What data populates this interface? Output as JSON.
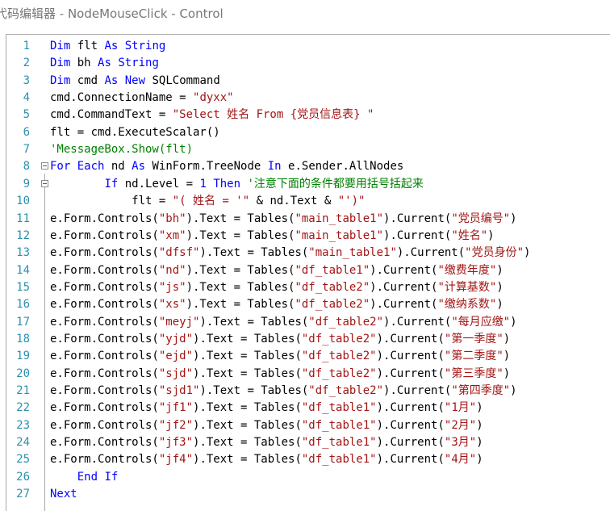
{
  "window": {
    "title": "代码编辑器 - NodeMouseClick - Control"
  },
  "colors": {
    "keyword": "#0000ff",
    "string": "#a31515",
    "comment": "#008000",
    "line_number": "#2b91af",
    "text": "#000000"
  },
  "editor": {
    "lines": [
      {
        "n": "1",
        "fold": "",
        "segs": [
          {
            "t": "Dim",
            "c": "kw"
          },
          {
            "t": " flt ",
            "c": "pl"
          },
          {
            "t": "As",
            "c": "kw"
          },
          {
            "t": " ",
            "c": "pl"
          },
          {
            "t": "String",
            "c": "kw"
          }
        ]
      },
      {
        "n": "2",
        "fold": "",
        "segs": [
          {
            "t": "Dim",
            "c": "kw"
          },
          {
            "t": " bh ",
            "c": "pl"
          },
          {
            "t": "As",
            "c": "kw"
          },
          {
            "t": " ",
            "c": "pl"
          },
          {
            "t": "String",
            "c": "kw"
          }
        ]
      },
      {
        "n": "3",
        "fold": "",
        "segs": [
          {
            "t": "Dim",
            "c": "kw"
          },
          {
            "t": " cmd ",
            "c": "pl"
          },
          {
            "t": "As",
            "c": "kw"
          },
          {
            "t": " ",
            "c": "pl"
          },
          {
            "t": "New",
            "c": "kw"
          },
          {
            "t": " SQLCommand",
            "c": "pl"
          }
        ]
      },
      {
        "n": "4",
        "fold": "",
        "segs": [
          {
            "t": "cmd.ConnectionName = ",
            "c": "pl"
          },
          {
            "t": "\"dyxx\"",
            "c": "str"
          }
        ]
      },
      {
        "n": "5",
        "fold": "",
        "segs": [
          {
            "t": "cmd.CommandText = ",
            "c": "pl"
          },
          {
            "t": "\"Select 姓名 From {党员信息表} \"",
            "c": "str"
          }
        ]
      },
      {
        "n": "6",
        "fold": "",
        "segs": [
          {
            "t": "flt = cmd.ExecuteScalar()",
            "c": "pl"
          }
        ]
      },
      {
        "n": "7",
        "fold": "",
        "segs": [
          {
            "t": "'MessageBox.Show(flt)",
            "c": "cmt"
          }
        ]
      },
      {
        "n": "8",
        "fold": "box",
        "segs": [
          {
            "t": "For",
            "c": "kw"
          },
          {
            "t": " ",
            "c": "pl"
          },
          {
            "t": "Each",
            "c": "kw"
          },
          {
            "t": " nd ",
            "c": "pl"
          },
          {
            "t": "As",
            "c": "kw"
          },
          {
            "t": " WinForm.TreeNode ",
            "c": "pl"
          },
          {
            "t": "In",
            "c": "kw"
          },
          {
            "t": " e.Sender.AllNodes",
            "c": "pl"
          }
        ]
      },
      {
        "n": "9",
        "fold": "box",
        "segs": [
          {
            "t": "        ",
            "c": "pl"
          },
          {
            "t": "If",
            "c": "kw"
          },
          {
            "t": " nd.Level = ",
            "c": "pl"
          },
          {
            "t": "1",
            "c": "num"
          },
          {
            "t": " ",
            "c": "pl"
          },
          {
            "t": "Then",
            "c": "kw"
          },
          {
            "t": " '注意下面的条件都要用括号括起来",
            "c": "cmt"
          }
        ]
      },
      {
        "n": "10",
        "fold": "",
        "segs": [
          {
            "t": "            flt = ",
            "c": "pl"
          },
          {
            "t": "\"( 姓名 = '\"",
            "c": "str"
          },
          {
            "t": " & nd.Text & ",
            "c": "pl"
          },
          {
            "t": "\"')\"",
            "c": "str"
          }
        ]
      },
      {
        "n": "11",
        "fold": "",
        "segs": [
          {
            "t": "e.Form.Controls(",
            "c": "pl"
          },
          {
            "t": "\"bh\"",
            "c": "str"
          },
          {
            "t": ").Text = Tables(",
            "c": "pl"
          },
          {
            "t": "\"main_table1\"",
            "c": "str"
          },
          {
            "t": ").Current(",
            "c": "pl"
          },
          {
            "t": "\"党员编号\"",
            "c": "str"
          },
          {
            "t": ")",
            "c": "pl"
          }
        ]
      },
      {
        "n": "12",
        "fold": "",
        "segs": [
          {
            "t": "e.Form.Controls(",
            "c": "pl"
          },
          {
            "t": "\"xm\"",
            "c": "str"
          },
          {
            "t": ").Text = Tables(",
            "c": "pl"
          },
          {
            "t": "\"main_table1\"",
            "c": "str"
          },
          {
            "t": ").Current(",
            "c": "pl"
          },
          {
            "t": "\"姓名\"",
            "c": "str"
          },
          {
            "t": ")",
            "c": "pl"
          }
        ]
      },
      {
        "n": "13",
        "fold": "",
        "segs": [
          {
            "t": "e.Form.Controls(",
            "c": "pl"
          },
          {
            "t": "\"dfsf\"",
            "c": "str"
          },
          {
            "t": ").Text = Tables(",
            "c": "pl"
          },
          {
            "t": "\"main_table1\"",
            "c": "str"
          },
          {
            "t": ").Current(",
            "c": "pl"
          },
          {
            "t": "\"党员身份\"",
            "c": "str"
          },
          {
            "t": ")",
            "c": "pl"
          }
        ]
      },
      {
        "n": "14",
        "fold": "",
        "segs": [
          {
            "t": "e.Form.Controls(",
            "c": "pl"
          },
          {
            "t": "\"nd\"",
            "c": "str"
          },
          {
            "t": ").Text = Tables(",
            "c": "pl"
          },
          {
            "t": "\"df_table1\"",
            "c": "str"
          },
          {
            "t": ").Current(",
            "c": "pl"
          },
          {
            "t": "\"缴费年度\"",
            "c": "str"
          },
          {
            "t": ")",
            "c": "pl"
          }
        ]
      },
      {
        "n": "15",
        "fold": "",
        "segs": [
          {
            "t": "e.Form.Controls(",
            "c": "pl"
          },
          {
            "t": "\"js\"",
            "c": "str"
          },
          {
            "t": ").Text = Tables(",
            "c": "pl"
          },
          {
            "t": "\"df_table2\"",
            "c": "str"
          },
          {
            "t": ").Current(",
            "c": "pl"
          },
          {
            "t": "\"计算基数\"",
            "c": "str"
          },
          {
            "t": ")",
            "c": "pl"
          }
        ]
      },
      {
        "n": "16",
        "fold": "",
        "segs": [
          {
            "t": "e.Form.Controls(",
            "c": "pl"
          },
          {
            "t": "\"xs\"",
            "c": "str"
          },
          {
            "t": ").Text = Tables(",
            "c": "pl"
          },
          {
            "t": "\"df_table2\"",
            "c": "str"
          },
          {
            "t": ").Current(",
            "c": "pl"
          },
          {
            "t": "\"缴纳系数\"",
            "c": "str"
          },
          {
            "t": ")",
            "c": "pl"
          }
        ]
      },
      {
        "n": "17",
        "fold": "",
        "segs": [
          {
            "t": "e.Form.Controls(",
            "c": "pl"
          },
          {
            "t": "\"meyj\"",
            "c": "str"
          },
          {
            "t": ").Text = Tables(",
            "c": "pl"
          },
          {
            "t": "\"df_table2\"",
            "c": "str"
          },
          {
            "t": ").Current(",
            "c": "pl"
          },
          {
            "t": "\"每月应缴\"",
            "c": "str"
          },
          {
            "t": ")",
            "c": "pl"
          }
        ]
      },
      {
        "n": "18",
        "fold": "",
        "segs": [
          {
            "t": "e.Form.Controls(",
            "c": "pl"
          },
          {
            "t": "\"yjd\"",
            "c": "str"
          },
          {
            "t": ").Text = Tables(",
            "c": "pl"
          },
          {
            "t": "\"df_table2\"",
            "c": "str"
          },
          {
            "t": ").Current(",
            "c": "pl"
          },
          {
            "t": "\"第一季度\"",
            "c": "str"
          },
          {
            "t": ")",
            "c": "pl"
          }
        ]
      },
      {
        "n": "19",
        "fold": "",
        "segs": [
          {
            "t": "e.Form.Controls(",
            "c": "pl"
          },
          {
            "t": "\"ejd\"",
            "c": "str"
          },
          {
            "t": ").Text = Tables(",
            "c": "pl"
          },
          {
            "t": "\"df_table2\"",
            "c": "str"
          },
          {
            "t": ").Current(",
            "c": "pl"
          },
          {
            "t": "\"第二季度\"",
            "c": "str"
          },
          {
            "t": ")",
            "c": "pl"
          }
        ]
      },
      {
        "n": "20",
        "fold": "",
        "segs": [
          {
            "t": "e.Form.Controls(",
            "c": "pl"
          },
          {
            "t": "\"sjd\"",
            "c": "str"
          },
          {
            "t": ").Text = Tables(",
            "c": "pl"
          },
          {
            "t": "\"df_table2\"",
            "c": "str"
          },
          {
            "t": ").Current(",
            "c": "pl"
          },
          {
            "t": "\"第三季度\"",
            "c": "str"
          },
          {
            "t": ")",
            "c": "pl"
          }
        ]
      },
      {
        "n": "21",
        "fold": "",
        "segs": [
          {
            "t": "e.Form.Controls(",
            "c": "pl"
          },
          {
            "t": "\"sjd1\"",
            "c": "str"
          },
          {
            "t": ").Text = Tables(",
            "c": "pl"
          },
          {
            "t": "\"df_table2\"",
            "c": "str"
          },
          {
            "t": ").Current(",
            "c": "pl"
          },
          {
            "t": "\"第四季度\"",
            "c": "str"
          },
          {
            "t": ")",
            "c": "pl"
          }
        ]
      },
      {
        "n": "22",
        "fold": "",
        "segs": [
          {
            "t": "e.Form.Controls(",
            "c": "pl"
          },
          {
            "t": "\"jf1\"",
            "c": "str"
          },
          {
            "t": ").Text = Tables(",
            "c": "pl"
          },
          {
            "t": "\"df_table1\"",
            "c": "str"
          },
          {
            "t": ").Current(",
            "c": "pl"
          },
          {
            "t": "\"1月\"",
            "c": "str"
          },
          {
            "t": ")",
            "c": "pl"
          }
        ]
      },
      {
        "n": "23",
        "fold": "",
        "segs": [
          {
            "t": "e.Form.Controls(",
            "c": "pl"
          },
          {
            "t": "\"jf2\"",
            "c": "str"
          },
          {
            "t": ").Text = Tables(",
            "c": "pl"
          },
          {
            "t": "\"df_table1\"",
            "c": "str"
          },
          {
            "t": ").Current(",
            "c": "pl"
          },
          {
            "t": "\"2月\"",
            "c": "str"
          },
          {
            "t": ")",
            "c": "pl"
          }
        ]
      },
      {
        "n": "24",
        "fold": "",
        "segs": [
          {
            "t": "e.Form.Controls(",
            "c": "pl"
          },
          {
            "t": "\"jf3\"",
            "c": "str"
          },
          {
            "t": ").Text = Tables(",
            "c": "pl"
          },
          {
            "t": "\"df_table1\"",
            "c": "str"
          },
          {
            "t": ").Current(",
            "c": "pl"
          },
          {
            "t": "\"3月\"",
            "c": "str"
          },
          {
            "t": ")",
            "c": "pl"
          }
        ]
      },
      {
        "n": "25",
        "fold": "",
        "segs": [
          {
            "t": "e.Form.Controls(",
            "c": "pl"
          },
          {
            "t": "\"jf4\"",
            "c": "str"
          },
          {
            "t": ").Text = Tables(",
            "c": "pl"
          },
          {
            "t": "\"df_table1\"",
            "c": "str"
          },
          {
            "t": ").Current(",
            "c": "pl"
          },
          {
            "t": "\"4月\"",
            "c": "str"
          },
          {
            "t": ")",
            "c": "pl"
          }
        ]
      },
      {
        "n": "26",
        "fold": "",
        "segs": [
          {
            "t": "    ",
            "c": "pl"
          },
          {
            "t": "End",
            "c": "kw"
          },
          {
            "t": " ",
            "c": "pl"
          },
          {
            "t": "If",
            "c": "kw"
          }
        ]
      },
      {
        "n": "27",
        "fold": "",
        "segs": [
          {
            "t": "Next",
            "c": "kw"
          }
        ]
      }
    ]
  }
}
